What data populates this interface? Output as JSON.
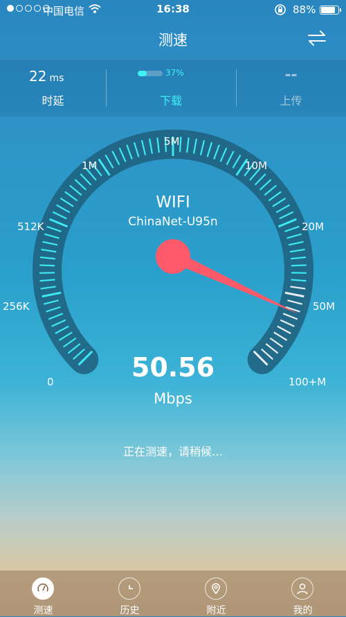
{
  "status_bar": {
    "carrier": "中国电信",
    "time": "16:38",
    "battery_percent": "88%",
    "battery_level": 0.88,
    "signal_bars_filled": 1
  },
  "header": {
    "title": "测速"
  },
  "stats": {
    "latency": {
      "value": "22",
      "unit": "ms",
      "label": "时延"
    },
    "download": {
      "progress_text": "37%",
      "progress": 0.37,
      "label": "下载"
    },
    "upload": {
      "value": "--",
      "label": "上传"
    }
  },
  "gauge": {
    "labels": [
      "0",
      "256K",
      "512K",
      "1M",
      "5M",
      "10M",
      "20M",
      "50M",
      "100+M"
    ],
    "connection_type": "WIFI",
    "network_name": "ChinaNet-U95n",
    "speed_value": "50.56",
    "speed_unit": "Mbps",
    "needle_reading": "50M"
  },
  "status_message": "正在测速，请稍候…",
  "tabs": [
    {
      "label": "测速",
      "icon": "speedometer-icon",
      "active": true
    },
    {
      "label": "历史",
      "icon": "clock-icon",
      "active": false
    },
    {
      "label": "附近",
      "icon": "location-pin-icon",
      "active": false
    },
    {
      "label": "我的",
      "icon": "user-icon",
      "active": false
    }
  ],
  "colors": {
    "accent": "#3ff0f8",
    "needle": "#ff5a6a",
    "dial_track": "#1f5f7d"
  }
}
